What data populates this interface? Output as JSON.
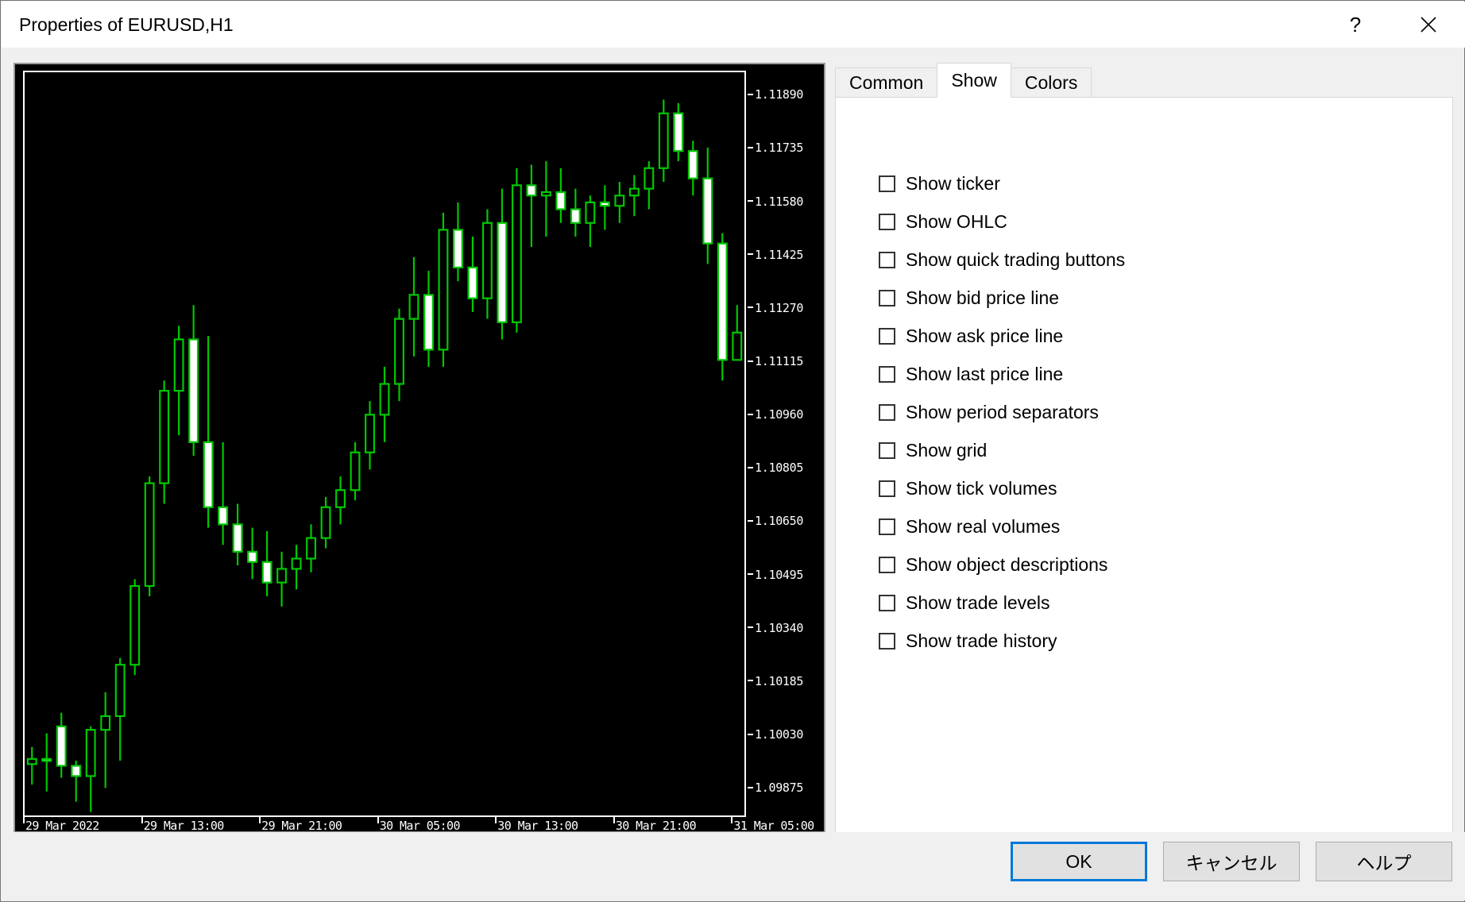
{
  "window": {
    "title": "Properties of EURUSD,H1",
    "help_icon": "question-mark-icon",
    "close_icon": "close-icon"
  },
  "tabs": [
    {
      "label": "Common",
      "active": false
    },
    {
      "label": "Show",
      "active": true
    },
    {
      "label": "Colors",
      "active": false
    }
  ],
  "show_options": [
    {
      "label": "Show ticker",
      "checked": false
    },
    {
      "label": "Show OHLC",
      "checked": false
    },
    {
      "label": "Show quick trading buttons",
      "checked": false
    },
    {
      "label": "Show bid price line",
      "checked": false
    },
    {
      "label": "Show ask price line",
      "checked": false
    },
    {
      "label": "Show last price line",
      "checked": false
    },
    {
      "label": "Show period separators",
      "checked": false
    },
    {
      "label": "Show grid",
      "checked": false
    },
    {
      "label": "Show tick volumes",
      "checked": false
    },
    {
      "label": "Show real volumes",
      "checked": false
    },
    {
      "label": "Show object descriptions",
      "checked": false
    },
    {
      "label": "Show trade levels",
      "checked": false
    },
    {
      "label": "Show trade history",
      "checked": false
    }
  ],
  "buttons": [
    {
      "label": "OK",
      "default": true
    },
    {
      "label": "キャンセル",
      "default": false
    },
    {
      "label": "ヘルプ",
      "default": false
    }
  ],
  "colors": {
    "background": "#000000",
    "foreground": "#ffffff",
    "candle_outline": "#00c800",
    "candle_bear_fill": "#ffffff",
    "candle_bull_fill": "#000000",
    "accent": "#0078d7",
    "dialog_bg": "#f0f0f0"
  },
  "chart_data": {
    "type": "candlestick",
    "title": "EURUSD,H1",
    "symbol": "EURUSD",
    "timeframe": "H1",
    "xlabel": "",
    "ylabel": "",
    "grid": false,
    "legend": "none",
    "ylim": [
      1.0979,
      1.1196
    ],
    "y_ticks": [
      "1.11890",
      "1.11735",
      "1.11580",
      "1.11425",
      "1.11270",
      "1.11115",
      "1.10960",
      "1.10805",
      "1.10650",
      "1.10495",
      "1.10340",
      "1.10185",
      "1.10030",
      "1.09875"
    ],
    "y_tick_values": [
      1.1189,
      1.11735,
      1.1158,
      1.11425,
      1.1127,
      1.11115,
      1.1096,
      1.10805,
      1.1065,
      1.10495,
      1.1034,
      1.10185,
      1.1003,
      1.09875
    ],
    "x_ticks": [
      "29 Mar 2022",
      "29 Mar 13:00",
      "29 Mar 21:00",
      "30 Mar 05:00",
      "30 Mar 13:00",
      "30 Mar 21:00",
      "31 Mar 05:00"
    ],
    "x_tick_positions": [
      0,
      8,
      16,
      24,
      32,
      40,
      48
    ],
    "candles": [
      {
        "o": 1.0994,
        "h": 1.0999,
        "l": 1.0988,
        "c": 1.09955
      },
      {
        "o": 1.09955,
        "h": 1.1003,
        "l": 1.0986,
        "c": 1.0995
      },
      {
        "o": 1.1005,
        "h": 1.1009,
        "l": 1.099,
        "c": 1.09935
      },
      {
        "o": 1.09935,
        "h": 1.0995,
        "l": 1.0983,
        "c": 1.09905
      },
      {
        "o": 1.09905,
        "h": 1.1005,
        "l": 1.098,
        "c": 1.1004
      },
      {
        "o": 1.1004,
        "h": 1.1015,
        "l": 1.0987,
        "c": 1.1008
      },
      {
        "o": 1.1008,
        "h": 1.1025,
        "l": 1.0995,
        "c": 1.1023
      },
      {
        "o": 1.1023,
        "h": 1.1048,
        "l": 1.102,
        "c": 1.1046
      },
      {
        "o": 1.1046,
        "h": 1.1078,
        "l": 1.1043,
        "c": 1.1076
      },
      {
        "o": 1.1076,
        "h": 1.1106,
        "l": 1.107,
        "c": 1.1103
      },
      {
        "o": 1.1103,
        "h": 1.1122,
        "l": 1.109,
        "c": 1.1118
      },
      {
        "o": 1.1118,
        "h": 1.1128,
        "l": 1.1084,
        "c": 1.1088
      },
      {
        "o": 1.1088,
        "h": 1.1119,
        "l": 1.1063,
        "c": 1.1069
      },
      {
        "o": 1.1069,
        "h": 1.1088,
        "l": 1.1058,
        "c": 1.1064
      },
      {
        "o": 1.1064,
        "h": 1.107,
        "l": 1.1052,
        "c": 1.1056
      },
      {
        "o": 1.1056,
        "h": 1.1063,
        "l": 1.1048,
        "c": 1.1053
      },
      {
        "o": 1.1053,
        "h": 1.1062,
        "l": 1.1043,
        "c": 1.1047
      },
      {
        "o": 1.1047,
        "h": 1.1056,
        "l": 1.104,
        "c": 1.1051
      },
      {
        "o": 1.1051,
        "h": 1.1058,
        "l": 1.1045,
        "c": 1.1054
      },
      {
        "o": 1.1054,
        "h": 1.1064,
        "l": 1.105,
        "c": 1.106
      },
      {
        "o": 1.106,
        "h": 1.1072,
        "l": 1.1057,
        "c": 1.1069
      },
      {
        "o": 1.1069,
        "h": 1.1078,
        "l": 1.1064,
        "c": 1.1074
      },
      {
        "o": 1.1074,
        "h": 1.1088,
        "l": 1.1071,
        "c": 1.1085
      },
      {
        "o": 1.1085,
        "h": 1.11,
        "l": 1.108,
        "c": 1.1096
      },
      {
        "o": 1.1096,
        "h": 1.111,
        "l": 1.1088,
        "c": 1.1105
      },
      {
        "o": 1.1105,
        "h": 1.1127,
        "l": 1.11,
        "c": 1.1124
      },
      {
        "o": 1.1124,
        "h": 1.1142,
        "l": 1.1113,
        "c": 1.1131
      },
      {
        "o": 1.1131,
        "h": 1.1138,
        "l": 1.111,
        "c": 1.1115
      },
      {
        "o": 1.1115,
        "h": 1.1155,
        "l": 1.111,
        "c": 1.115
      },
      {
        "o": 1.115,
        "h": 1.1158,
        "l": 1.1135,
        "c": 1.1139
      },
      {
        "o": 1.1139,
        "h": 1.1148,
        "l": 1.1126,
        "c": 1.113
      },
      {
        "o": 1.113,
        "h": 1.1156,
        "l": 1.1124,
        "c": 1.1152
      },
      {
        "o": 1.1152,
        "h": 1.1162,
        "l": 1.1118,
        "c": 1.1123
      },
      {
        "o": 1.1123,
        "h": 1.1168,
        "l": 1.112,
        "c": 1.1163
      },
      {
        "o": 1.1163,
        "h": 1.1169,
        "l": 1.1145,
        "c": 1.116
      },
      {
        "o": 1.116,
        "h": 1.117,
        "l": 1.1148,
        "c": 1.1161
      },
      {
        "o": 1.1161,
        "h": 1.1168,
        "l": 1.1152,
        "c": 1.1156
      },
      {
        "o": 1.1156,
        "h": 1.1162,
        "l": 1.1148,
        "c": 1.1152
      },
      {
        "o": 1.1152,
        "h": 1.116,
        "l": 1.1145,
        "c": 1.1158
      },
      {
        "o": 1.1158,
        "h": 1.1163,
        "l": 1.115,
        "c": 1.1157
      },
      {
        "o": 1.1157,
        "h": 1.1164,
        "l": 1.1152,
        "c": 1.116
      },
      {
        "o": 1.116,
        "h": 1.1166,
        "l": 1.1154,
        "c": 1.1162
      },
      {
        "o": 1.1162,
        "h": 1.117,
        "l": 1.1156,
        "c": 1.1168
      },
      {
        "o": 1.1168,
        "h": 1.1188,
        "l": 1.1164,
        "c": 1.1184
      },
      {
        "o": 1.1184,
        "h": 1.1187,
        "l": 1.117,
        "c": 1.1173
      },
      {
        "o": 1.1173,
        "h": 1.1176,
        "l": 1.116,
        "c": 1.1165
      },
      {
        "o": 1.1165,
        "h": 1.1174,
        "l": 1.114,
        "c": 1.1146
      },
      {
        "o": 1.1146,
        "h": 1.1149,
        "l": 1.1106,
        "c": 1.1112
      },
      {
        "o": 1.1112,
        "h": 1.1128,
        "l": 1.1113,
        "c": 1.112
      }
    ]
  }
}
